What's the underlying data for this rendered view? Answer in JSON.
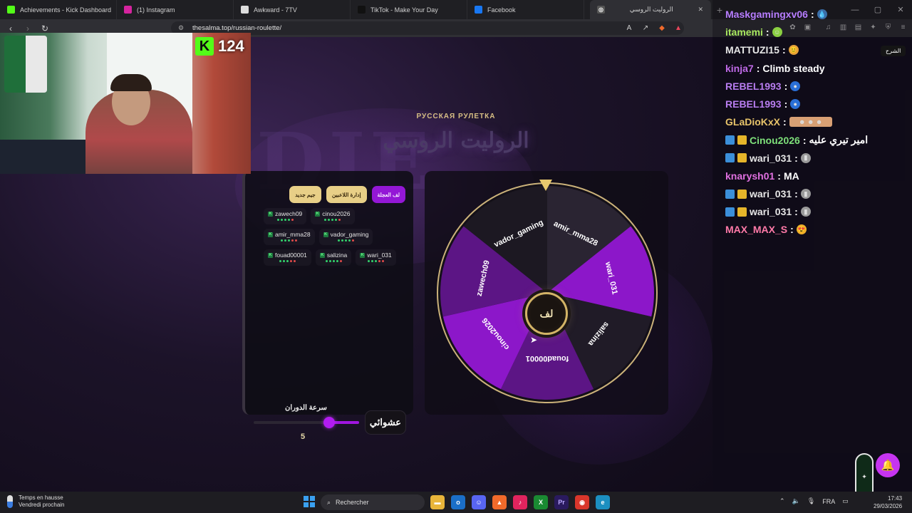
{
  "browser": {
    "tabs": [
      {
        "title": "Achievements - Kick Dashboard",
        "icon": "kick-icon",
        "color": "#53fc18"
      },
      {
        "title": "(1) Instagram",
        "icon": "instagram-icon",
        "color": "#d6249f"
      },
      {
        "title": "Awkward - 7TV",
        "icon": "7tv-icon",
        "color": "#dddddd"
      },
      {
        "title": "TikTok - Make Your Day",
        "icon": "tiktok-icon",
        "color": "#111111"
      },
      {
        "title": "Facebook",
        "icon": "facebook-icon",
        "color": "#1877f2"
      }
    ],
    "active_tab": "الروليت الروسي",
    "url": "thesalma.top/russian-roulette/"
  },
  "stream": {
    "viewer_count": "124"
  },
  "page": {
    "kicker": "РУССКАЯ РУЛЕТКА",
    "title": "الروليت الروسي",
    "bg_text": "DIE",
    "buttons": {
      "spin_wheel": "لف العجلة",
      "manage_players": "إدارة اللاعبين",
      "new_game": "جيم جديد"
    },
    "players": [
      {
        "name": "cinou2026",
        "dots": [
          "#32d36b",
          "#32d36b",
          "#32d36b",
          "#32d36b",
          "#e04a4a"
        ]
      },
      {
        "name": "zawech09",
        "dots": [
          "#32d36b",
          "#32d36b",
          "#32d36b",
          "#32d36b",
          "#e04a4a"
        ]
      },
      {
        "name": "vador_gaming",
        "dots": [
          "#32d36b",
          "#32d36b",
          "#32d36b",
          "#32d36b",
          "#e04a4a"
        ]
      },
      {
        "name": "amir_mma28",
        "dots": [
          "#32d36b",
          "#32d36b",
          "#32d36b",
          "#e04a4a",
          "#e04a4a"
        ]
      },
      {
        "name": "wari_031",
        "dots": [
          "#32d36b",
          "#32d36b",
          "#32d36b",
          "#e04a4a",
          "#e04a4a"
        ]
      },
      {
        "name": "salizina",
        "dots": [
          "#32d36b",
          "#32d36b",
          "#32d36b",
          "#32d36b",
          "#e04a4a"
        ]
      },
      {
        "name": "fouad00001",
        "dots": [
          "#32d36b",
          "#32d36b",
          "#32d36b",
          "#e04a4a",
          "#e04a4a"
        ]
      }
    ],
    "speed_label": "سرعة الدوران",
    "speed_value": "5",
    "speed_fraction": 0.85,
    "random_label": "عشوائي",
    "spin_label": "لف",
    "wheel_segments": [
      {
        "name": "amir_mma28",
        "color": "#2a2432"
      },
      {
        "name": "wari_031",
        "color": "#8c17c9"
      },
      {
        "name": "salizina",
        "color": "#201b27"
      },
      {
        "name": "fouad00001",
        "color": "#5c1585"
      },
      {
        "name": "cinou2026",
        "color": "#8c17c9"
      },
      {
        "name": "zawech09",
        "color": "#5c1585"
      },
      {
        "name": "vador_gaming",
        "color": "#1c1822"
      }
    ]
  },
  "chat": {
    "lines": [
      {
        "user": "Maskgamingxv06",
        "color": "#b77dff",
        "msg": "",
        "emote": "💧",
        "emote_bg": "#3a6ea8"
      },
      {
        "user": "itamemi",
        "color": "#a8e860",
        "msg": "",
        "emote": "☺",
        "emote_bg": "#8bd042"
      },
      {
        "user": "MATTUZI15",
        "color": "#e6e6e6",
        "msg": "",
        "emote": "😊",
        "emote_bg": "#e7a23a"
      },
      {
        "user": "kinja7",
        "color": "#c06ae8",
        "msg": "Climb steady",
        "emote": "",
        "emote_bg": ""
      },
      {
        "user": "REBEL1993",
        "color": "#b87df0",
        "msg": "",
        "emote": "●",
        "emote_bg": "#2a6fd6"
      },
      {
        "user": "REBEL1993",
        "color": "#b87df0",
        "msg": "",
        "emote": "●",
        "emote_bg": "#2a6fd6"
      },
      {
        "user": "GLaDioKxX",
        "color": "#e8c46a",
        "msg": "",
        "emote": "☻ ☻ ☻",
        "emote_bg": "#d8a074"
      },
      {
        "user": "Cinou2026",
        "color": "#7ee07a",
        "msg": "امير تيري عليه",
        "emote": "",
        "emote_bg": "",
        "badges": true
      },
      {
        "user": "wari_031",
        "color": "#e6e6e6",
        "msg": "",
        "emote": "▮",
        "emote_bg": "#9a9a9a",
        "badges": true
      },
      {
        "user": "knarysh01",
        "color": "#e070e0",
        "msg": "MA",
        "emote": "",
        "emote_bg": ""
      },
      {
        "user": "wari_031",
        "color": "#e6e6e6",
        "msg": "",
        "emote": "▮",
        "emote_bg": "#9a9a9a",
        "badges": true
      },
      {
        "user": "wari_031",
        "color": "#e6e6e6",
        "msg": "",
        "emote": "▮",
        "emote_bg": "#9a9a9a",
        "badges": true
      },
      {
        "user": "MAX_MAX_S",
        "color": "#ff7aa8",
        "msg": "",
        "emote": "😍",
        "emote_bg": "#f0b02a"
      }
    ],
    "tooltip": "الشرح"
  },
  "taskbar": {
    "weather_title": "Temps en hausse",
    "weather_sub": "Vendredi prochain",
    "search_placeholder": "Rechercher",
    "lang": "FRA",
    "time": "17:43",
    "date": "29/03/2026"
  }
}
